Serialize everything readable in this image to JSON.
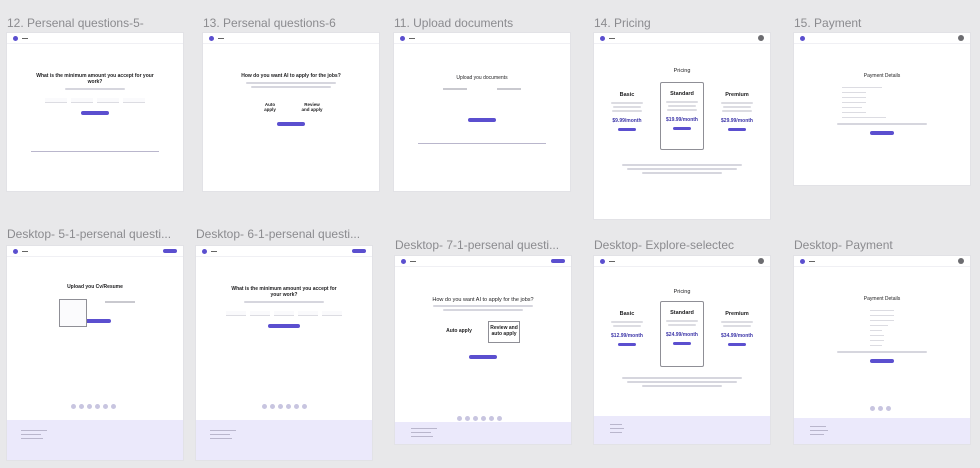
{
  "frames": [
    {
      "id": "f1",
      "label": "12. Persenal questions-5-"
    },
    {
      "id": "f2",
      "label": "13. Persenal questions-6"
    },
    {
      "id": "f3",
      "label": "11. Upload documents"
    },
    {
      "id": "f4",
      "label": "14. Pricing"
    },
    {
      "id": "f5",
      "label": "15. Payment"
    },
    {
      "id": "f6",
      "label": "Desktop- 5-1-persenal questi..."
    },
    {
      "id": "f7",
      "label": "Desktop- 6-1-persenal questi..."
    },
    {
      "id": "f8",
      "label": "Desktop- 7-1-persenal questi..."
    },
    {
      "id": "f9",
      "label": "Desktop- Explore-selectec"
    },
    {
      "id": "f10",
      "label": "Desktop- Payment"
    }
  ],
  "content": {
    "min_amount_heading": "What is the minimum amount you accept for your work?",
    "ai_apply_heading": "How do you want AI to apply for the jobs?",
    "choice_auto": "Auto apply",
    "choice_review": "Review and apply",
    "choice_review_auto": "Review and auto apply",
    "upload_documents": "Upload you documents",
    "upload_cv": "Upload you Cv/Resume",
    "pricing_title": "Pricing",
    "payment_title": "Payment Details",
    "plans_top": [
      {
        "name": "Basic",
        "price": "$9.99/month"
      },
      {
        "name": "Standard",
        "price": "$19.99/month"
      },
      {
        "name": "Premium",
        "price": "$29.99/month"
      }
    ],
    "plans_bottom": [
      {
        "name": "Basic",
        "price": "$12.99/month"
      },
      {
        "name": "Standard",
        "price": "$24.99/month"
      },
      {
        "name": "Premium",
        "price": "$34.99/month"
      }
    ]
  }
}
